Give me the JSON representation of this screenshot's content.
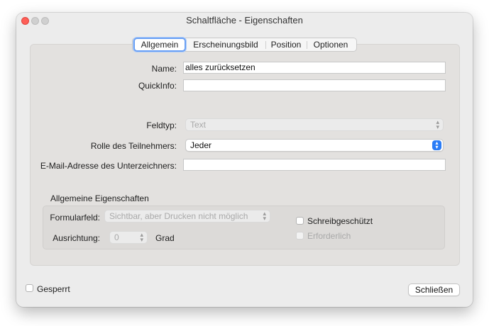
{
  "window": {
    "title": "Schaltfläche - Eigenschaften"
  },
  "tabs": [
    "Allgemein",
    "Erscheinungsbild",
    "Position",
    "Optionen"
  ],
  "form": {
    "name_label": "Name:",
    "name_value": "alles zurücksetzen",
    "quickinfo_label": "QuickInfo:",
    "quickinfo_value": "",
    "feldtyp_label": "Feldtyp:",
    "feldtyp_value": "Text",
    "rolle_label": "Rolle des Teilnehmers:",
    "rolle_value": "Jeder",
    "email_label": "E-Mail-Adresse des Unterzeichners:",
    "email_value": ""
  },
  "general": {
    "title": "Allgemeine Eigenschaften",
    "formularfeld_label": "Formularfeld:",
    "formularfeld_value": "Sichtbar, aber Drucken nicht möglich",
    "ausrichtung_label": "Ausrichtung:",
    "ausrichtung_value": "0",
    "grad_label": "Grad",
    "schreibgeschuetzt_label": "Schreibgeschützt",
    "erforderlich_label": "Erforderlich"
  },
  "footer": {
    "gesperrt_label": "Gesperrt",
    "close_label": "Schließen"
  }
}
